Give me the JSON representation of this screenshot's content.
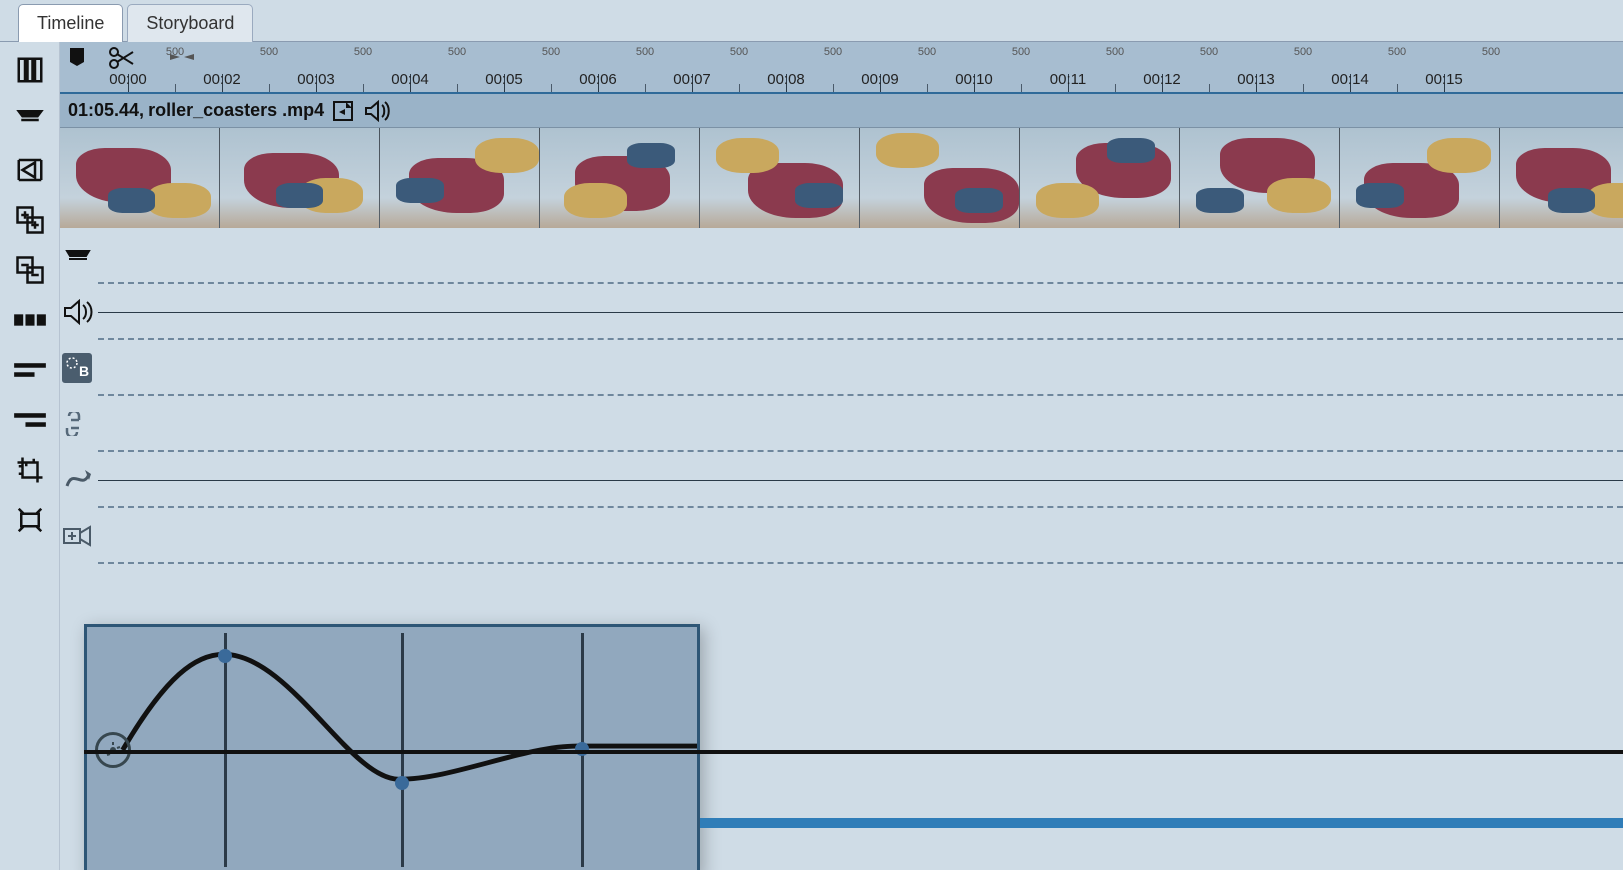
{
  "tabs": {
    "timeline": "Timeline",
    "storyboard": "Storyboard"
  },
  "clip": {
    "duration": "01:05.44,",
    "name": "roller_coasters .mp4"
  },
  "ruler": {
    "labels": [
      "00:00",
      "00:02",
      "00:03",
      "00:04",
      "00:05",
      "00:06",
      "00:07",
      "00:08",
      "00:09",
      "00:10",
      "00:11",
      "00:12",
      "00:13",
      "00:14",
      "00:15"
    ],
    "sublabel": "500"
  },
  "tool_icons": [
    "text-tool-icon",
    "cut-top-icon",
    "play-icon",
    "group-add-icon",
    "group-remove-icon",
    "thumbnails-icon",
    "align-left-icon",
    "align-right-icon",
    "crop-icon",
    "expand-icon"
  ]
}
